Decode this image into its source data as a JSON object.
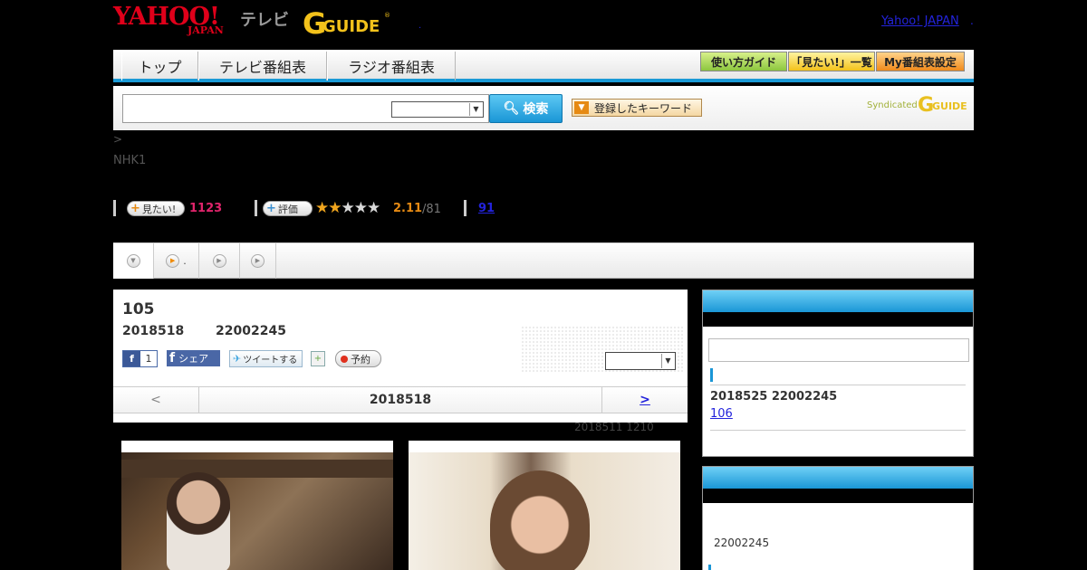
{
  "header": {
    "logo_yahoo": "YAHOO!",
    "logo_japan": "JAPAN",
    "logo_tv": "テレビ",
    "logo_gguide": "G GUIDE",
    "yahoo_japan_link": "Yahoo! JAPAN",
    "dot": "."
  },
  "nav": {
    "tabs": [
      "トップ",
      "テレビ番組表",
      "ラジオ番組表"
    ],
    "buttons": [
      "使い方ガイド",
      "「見たい!」一覧",
      "My番組表設定"
    ]
  },
  "search": {
    "input_value": "",
    "select_value": "",
    "button_label": "検索",
    "keyword_button_label": "登録したキーワード",
    "syndicated_label": "Syndicated",
    "syndicated_logo": "G GUIDE"
  },
  "breadcrumb": ">",
  "channel": "NHK1",
  "stats": {
    "wish_label": "見たい!",
    "wish_count": "1123",
    "rating_label": "評価",
    "rating_stars": 2.11,
    "rating_score": "2.11",
    "rating_total": "/81",
    "comment_count": "91"
  },
  "subtabs": {
    "tab2_label": "."
  },
  "episode": {
    "title": "105",
    "date": "2018518",
    "time": "22002245",
    "fb_like_count": "1",
    "fb_share_label": "シェア",
    "tweet_label": "ツイートする",
    "reserve_label": "予約",
    "select_value": "",
    "pager_prev": "<",
    "pager_current": "2018518",
    "pager_next": ">",
    "note": "2018511  1210"
  },
  "sidebar": {
    "box1_input": "",
    "box1_row1": "2018525  22002245",
    "box1_row2": "106",
    "box2_text": "22002245"
  },
  "colors": {
    "accent_blue": "#1a96d6",
    "wish_pink": "#e0246b",
    "rating_orange": "#e68a13",
    "link_blue": "#2323dc"
  }
}
